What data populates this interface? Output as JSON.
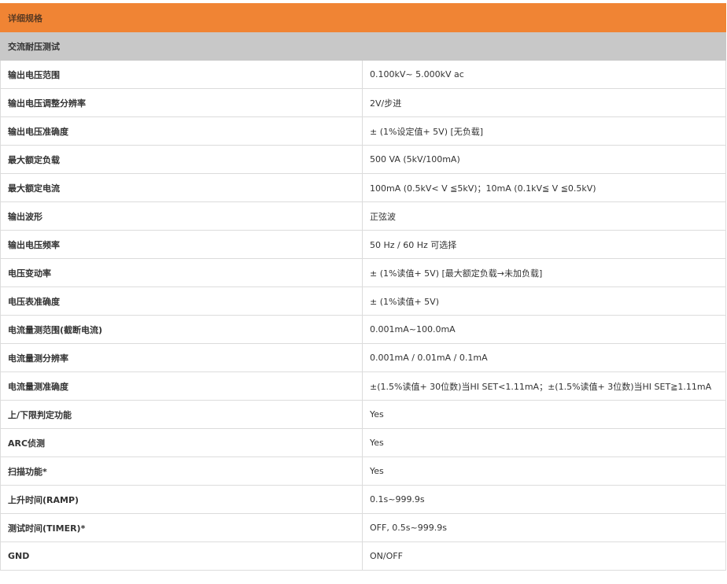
{
  "title": "详细规格",
  "section": "交流耐压测试",
  "colors": {
    "title_bar": "#f08434",
    "section_bar": "#c8c8c8",
    "border": "#dcdcdc"
  },
  "rows": [
    {
      "label": "输出电压范围",
      "value": "0.100kV~ 5.000kV ac"
    },
    {
      "label": "输出电压调整分辨率",
      "value": "2V/步进"
    },
    {
      "label": "输出电压准确度",
      "value": "± (1%设定值+ 5V) [无负载]"
    },
    {
      "label": "最大额定负载",
      "value": "500 VA (5kV/100mA)"
    },
    {
      "label": "最大额定电流",
      "value": "100mA (0.5kV< V ≦5kV)；10mA (0.1kV≦ V ≦0.5kV)"
    },
    {
      "label": "输出波形",
      "value": "正弦波"
    },
    {
      "label": "输出电压频率",
      "value": "50 Hz / 60 Hz 可选择"
    },
    {
      "label": "电压变动率",
      "value": "± (1%读值+ 5V) [最大额定负载→未加负载]"
    },
    {
      "label": "电压表准确度",
      "value": "± (1%读值+ 5V)"
    },
    {
      "label": "电流量测范围(截断电流)",
      "value": "0.001mA~100.0mA"
    },
    {
      "label": "电流量测分辨率",
      "value": "0.001mA / 0.01mA / 0.1mA"
    },
    {
      "label": "电流量测准确度",
      "value": "±(1.5%读值+ 30位数)当HI SET<1.11mA；±(1.5%读值+ 3位数)当HI SET≧1.11mA"
    },
    {
      "label": "上/下限判定功能",
      "value": "Yes"
    },
    {
      "label": "ARC侦测",
      "value": "Yes"
    },
    {
      "label": "扫描功能*",
      "value": "Yes"
    },
    {
      "label": "上升时间(RAMP)",
      "value": "0.1s~999.9s"
    },
    {
      "label": "测试时间(TIMER)*",
      "value": "OFF, 0.5s~999.9s"
    },
    {
      "label": "GND",
      "value": "ON/OFF"
    }
  ]
}
